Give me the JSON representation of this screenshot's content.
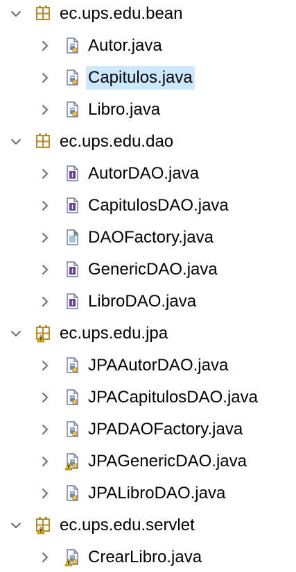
{
  "packages": [
    {
      "name": "ec.ups.edu.bean",
      "expanded": true,
      "warning": false,
      "files": [
        {
          "name": "Autor.java",
          "kind": "class",
          "warning": false,
          "selected": false
        },
        {
          "name": "Capitulos.java",
          "kind": "class",
          "warning": false,
          "selected": true
        },
        {
          "name": "Libro.java",
          "kind": "class",
          "warning": false,
          "selected": false
        }
      ]
    },
    {
      "name": "ec.ups.edu.dao",
      "expanded": true,
      "warning": false,
      "files": [
        {
          "name": "AutorDAO.java",
          "kind": "interface",
          "warning": false,
          "selected": false
        },
        {
          "name": "CapitulosDAO.java",
          "kind": "interface",
          "warning": false,
          "selected": false
        },
        {
          "name": "DAOFactory.java",
          "kind": "abstract-class",
          "warning": false,
          "selected": false
        },
        {
          "name": "GenericDAO.java",
          "kind": "interface",
          "warning": false,
          "selected": false
        },
        {
          "name": "LibroDAO.java",
          "kind": "interface",
          "warning": false,
          "selected": false
        }
      ]
    },
    {
      "name": "ec.ups.edu.jpa",
      "expanded": true,
      "warning": true,
      "files": [
        {
          "name": "JPAAutorDAO.java",
          "kind": "class",
          "warning": false,
          "selected": false
        },
        {
          "name": "JPACapitulosDAO.java",
          "kind": "class",
          "warning": false,
          "selected": false
        },
        {
          "name": "JPADAOFactory.java",
          "kind": "class",
          "warning": false,
          "selected": false
        },
        {
          "name": "JPAGenericDAO.java",
          "kind": "class",
          "warning": true,
          "selected": false
        },
        {
          "name": "JPALibroDAO.java",
          "kind": "class",
          "warning": false,
          "selected": false
        }
      ]
    },
    {
      "name": "ec.ups.edu.servlet",
      "expanded": true,
      "warning": true,
      "files": [
        {
          "name": "CrearLibro.java",
          "kind": "class",
          "warning": true,
          "selected": false
        }
      ]
    }
  ],
  "icons": {
    "package": "package-icon",
    "class": "java-class-file-icon",
    "interface": "java-interface-file-icon",
    "abstract-class": "java-abstract-class-file-icon",
    "expanded": "chevron-down-icon",
    "collapsed": "chevron-right-icon"
  },
  "colors": {
    "selection": "#cce8ff",
    "package": "#b88a2b",
    "interface": "#6b3fa0",
    "class_badge": "#6a8dc3",
    "abstract_badge": "#3e8f4a",
    "warning": "#f2b705",
    "chevron": "#6b6b6b"
  }
}
